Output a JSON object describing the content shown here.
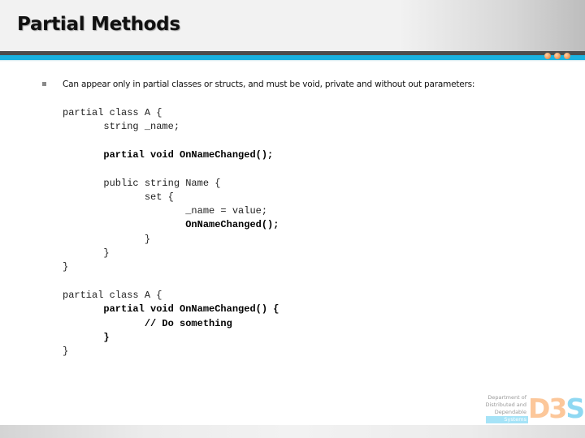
{
  "slide": {
    "title": "Partial Methods",
    "bullets": [
      {
        "text": "Can appear only in partial classes or structs, and must be void, private and without out parameters:"
      }
    ],
    "code_lines": [
      {
        "text": "partial class A {",
        "bold": false
      },
      {
        "text": "       string _name;",
        "bold": false
      },
      {
        "text": "",
        "bold": false
      },
      {
        "text": "       partial void OnNameChanged();",
        "bold": true
      },
      {
        "text": "",
        "bold": false
      },
      {
        "text": "       public string Name {",
        "bold": false
      },
      {
        "text": "              set {",
        "bold": false
      },
      {
        "text": "                     _name = value;",
        "bold": false
      },
      {
        "text": "                     OnNameChanged();",
        "bold": true
      },
      {
        "text": "              }",
        "bold": false
      },
      {
        "text": "       }",
        "bold": false
      },
      {
        "text": "}",
        "bold": false
      },
      {
        "text": "",
        "bold": false
      },
      {
        "text": "partial class A {",
        "bold": false
      },
      {
        "text": "       partial void OnNameChanged() {",
        "bold": true
      },
      {
        "text": "              // Do something",
        "bold": true
      },
      {
        "text": "       }",
        "bold": true
      },
      {
        "text": "}",
        "bold": false
      }
    ]
  },
  "logo": {
    "lines": [
      "Department of",
      "Distributed and",
      "Dependable"
    ],
    "highlight_line": "Systems",
    "mark": {
      "d": "D",
      "three": "3",
      "s": "S"
    }
  },
  "colors": {
    "accent_blue": "#1ab2e0",
    "dark_bar": "#4d4d4d",
    "dot_orange": "#f2a062"
  }
}
